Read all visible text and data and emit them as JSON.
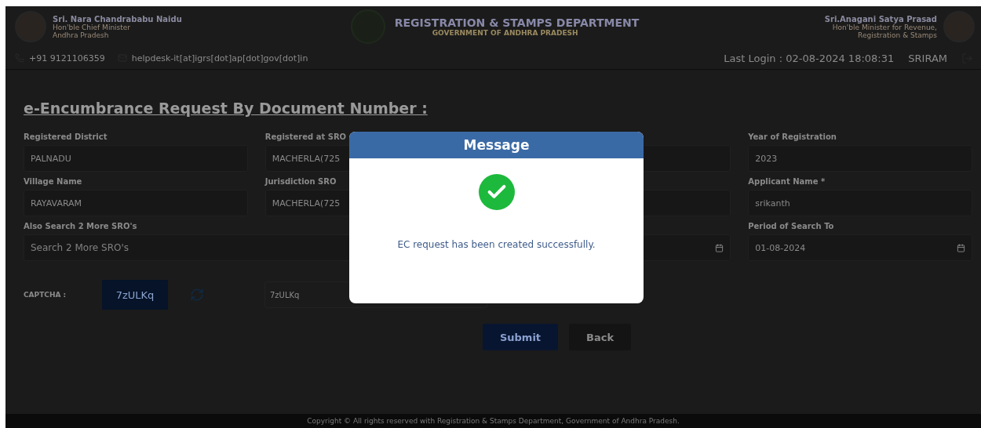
{
  "header": {
    "left_official": {
      "name": "Sri. Nara Chandrababu Naidu",
      "lines": [
        "Hon'ble Chief Minister",
        "Andhra Pradesh"
      ]
    },
    "department": {
      "title": "REGISTRATION & STAMPS DEPARTMENT",
      "subtitle": "GOVERNMENT OF ANDHRA PRADESH"
    },
    "right_official": {
      "name": "Sri.Anagani Satya Prasad",
      "lines": [
        "Hon'ble Minister for Revenue,",
        "Registration & Stamps"
      ]
    },
    "phone": "+91 9121106359",
    "email": "helpdesk-it[at]igrs[dot]ap[dot]gov[dot]in",
    "last_login": "Last Login : 02-08-2024 18:08:31",
    "user": "SRIRAM"
  },
  "page_title": "e-Encumbrance Request By Document Number :",
  "fields": [
    {
      "kind": "text",
      "label": "Registered District",
      "value": "PALNADU"
    },
    {
      "kind": "text",
      "label": "Registered at SRO",
      "value": "MACHERLA(725"
    },
    {
      "kind": "covered"
    },
    {
      "kind": "text",
      "label": "Year of Registration",
      "value": "2023"
    },
    {
      "kind": "text",
      "label": "Village Name",
      "value": "RAYAVARAM"
    },
    {
      "kind": "text",
      "label": "Jurisdiction SRO",
      "value": "MACHERLA(725"
    },
    {
      "kind": "covered"
    },
    {
      "kind": "text",
      "label": "Applicant Name *",
      "value": "srikanth"
    },
    {
      "kind": "search",
      "label": "Also Search 2 More SRO's",
      "placeholder": "Search 2 More SRO's"
    },
    {
      "kind": "covered-date"
    },
    {
      "kind": "date",
      "label": "Period of Search To",
      "value": "01-08-2024"
    }
  ],
  "captcha": {
    "label": "CAPTCHA :",
    "code": "7zULKq",
    "value": "7zULKq"
  },
  "buttons": [
    {
      "kind": "primary",
      "label": "Submit"
    },
    {
      "kind": "secondary",
      "label": "Back"
    }
  ],
  "modal": {
    "title": "Message",
    "message": "EC request has been created successfully."
  },
  "footer": "Copyright © All rights reserved with Registration & Stamps Department, Government of Andhra Pradesh."
}
